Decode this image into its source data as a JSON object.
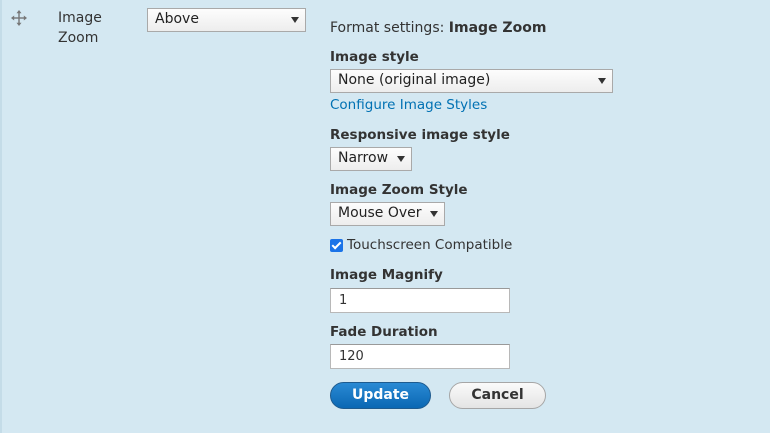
{
  "row": {
    "field_label": "Image Zoom",
    "label_display": "Above"
  },
  "settings": {
    "title_prefix": "Format settings:",
    "title_name": "Image Zoom",
    "image_style": {
      "label": "Image style",
      "value": "None (original image)",
      "configure_link": "Configure Image Styles"
    },
    "responsive_style": {
      "label": "Responsive image style",
      "value": "Narrow"
    },
    "zoom_style": {
      "label": "Image Zoom Style",
      "value": "Mouse Over"
    },
    "touchscreen": {
      "label": "Touchscreen Compatible",
      "checked": true
    },
    "magnify": {
      "label": "Image Magnify",
      "value": "1"
    },
    "fade_duration": {
      "label": "Fade Duration",
      "value": "120"
    }
  },
  "actions": {
    "update_label": "Update",
    "cancel_label": "Cancel"
  },
  "icons": {
    "drag_handle": "move-arrows-icon",
    "dropdown": "chevron-down-icon",
    "checkbox": "check-icon"
  },
  "colors": {
    "background": "#d4e8f2",
    "link": "#0071b3",
    "primary_button": "#0a67b3",
    "checkbox": "#1a73e8"
  }
}
